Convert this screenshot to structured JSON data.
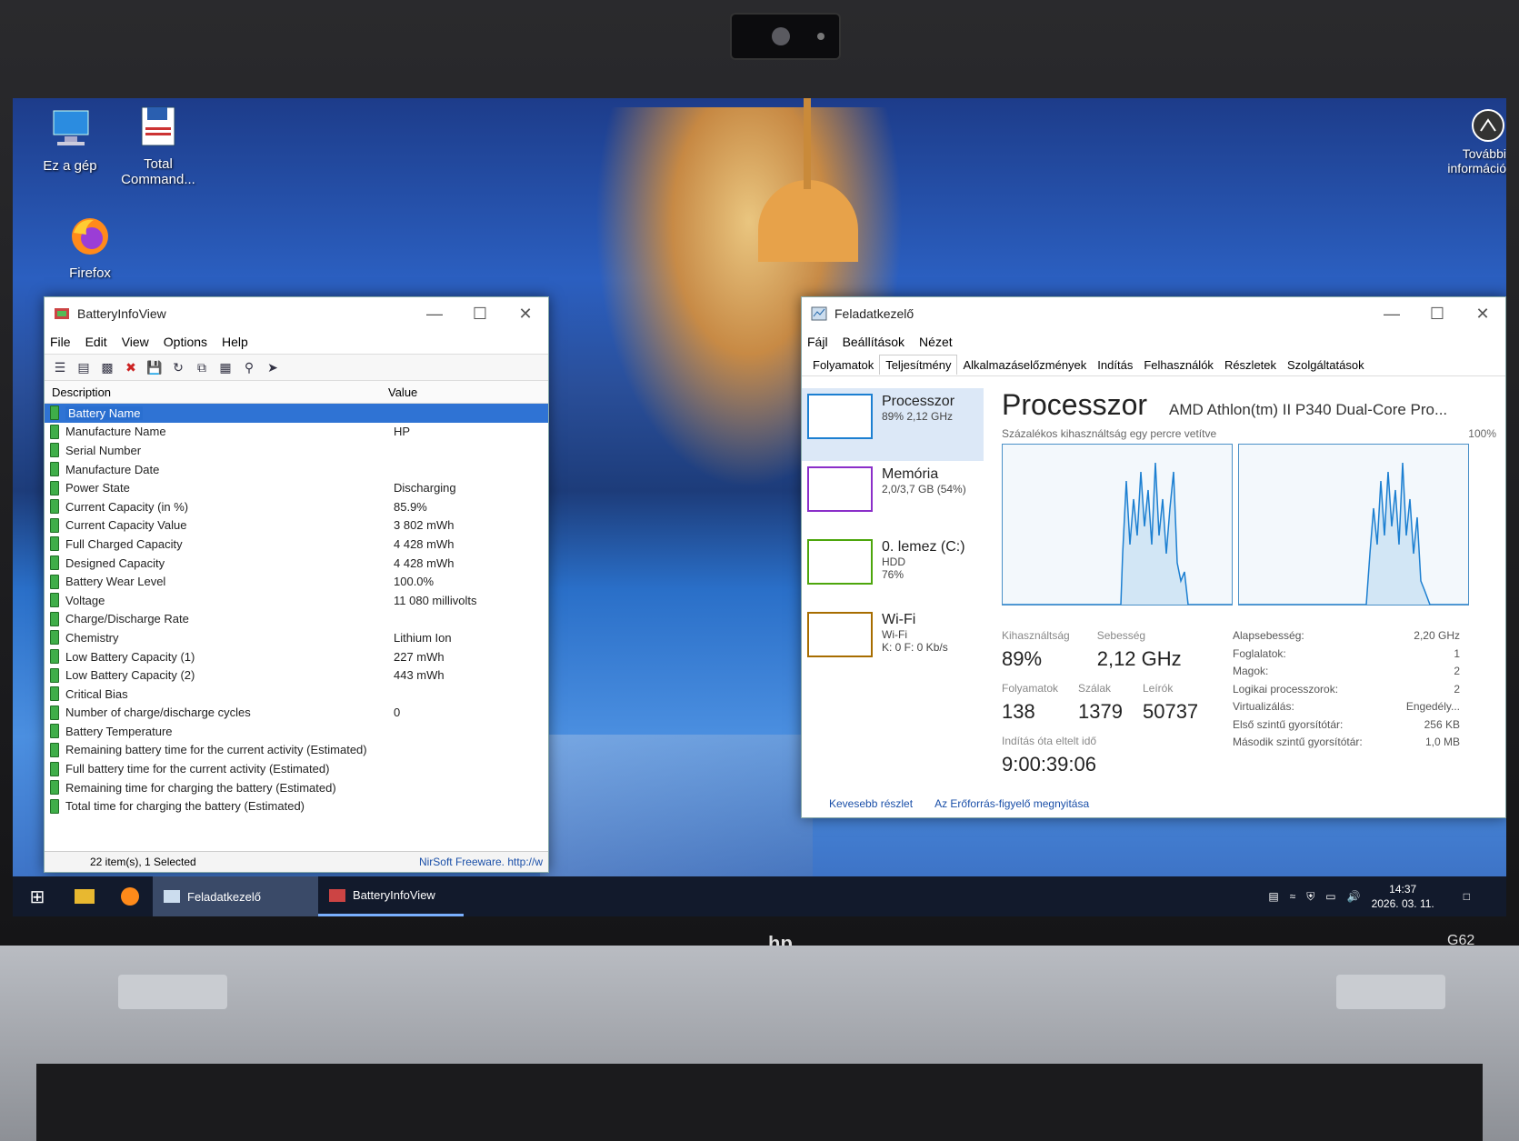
{
  "desktop": {
    "icons": [
      {
        "label": "Ez a gép",
        "icon": "computer-icon"
      },
      {
        "label": "Total Command...",
        "icon": "floppy-icon"
      },
      {
        "label": "Firefox",
        "icon": "firefox-icon"
      }
    ],
    "corner_label_line1": "További",
    "corner_label_line2": "információ"
  },
  "battery_window": {
    "title": "BatteryInfoView",
    "menu": [
      "File",
      "Edit",
      "View",
      "Options",
      "Help"
    ],
    "columns": [
      "Description",
      "Value"
    ],
    "rows": [
      {
        "desc": "Battery Name",
        "value": ""
      },
      {
        "desc": "Manufacture Name",
        "value": "HP"
      },
      {
        "desc": "Serial Number",
        "value": ""
      },
      {
        "desc": "Manufacture Date",
        "value": ""
      },
      {
        "desc": "Power State",
        "value": "Discharging"
      },
      {
        "desc": "Current Capacity (in %)",
        "value": "85.9%"
      },
      {
        "desc": "Current Capacity Value",
        "value": "3 802 mWh"
      },
      {
        "desc": "Full Charged Capacity",
        "value": "4 428 mWh"
      },
      {
        "desc": "Designed Capacity",
        "value": "4 428 mWh"
      },
      {
        "desc": "Battery Wear Level",
        "value": "100.0%"
      },
      {
        "desc": "Voltage",
        "value": "11 080 millivolts"
      },
      {
        "desc": "Charge/Discharge Rate",
        "value": ""
      },
      {
        "desc": "Chemistry",
        "value": "Lithium Ion"
      },
      {
        "desc": "Low Battery Capacity (1)",
        "value": "227 mWh"
      },
      {
        "desc": "Low Battery Capacity (2)",
        "value": "443 mWh"
      },
      {
        "desc": "Critical Bias",
        "value": ""
      },
      {
        "desc": "Number of charge/discharge cycles",
        "value": "0"
      },
      {
        "desc": "Battery Temperature",
        "value": ""
      },
      {
        "desc": "Remaining battery time for the current activity (Estimated)",
        "value": ""
      },
      {
        "desc": "Full battery time for the current activity (Estimated)",
        "value": ""
      },
      {
        "desc": "Remaining time for charging the battery (Estimated)",
        "value": ""
      },
      {
        "desc": "Total  time for charging the battery (Estimated)",
        "value": ""
      }
    ],
    "status_left": "22 item(s), 1 Selected",
    "status_right": "NirSoft Freeware.  http://w"
  },
  "task_manager": {
    "title": "Feladatkezelő",
    "menu": [
      "Fájl",
      "Beállítások",
      "Nézet"
    ],
    "tabs": [
      "Folyamatok",
      "Teljesítmény",
      "Alkalmazáselőzmények",
      "Indítás",
      "Felhasználók",
      "Részletek",
      "Szolgáltatások"
    ],
    "side": [
      {
        "name": "Processzor",
        "sub1": "89% 2,12 GHz",
        "sub2": "",
        "color": "#1c7fd1"
      },
      {
        "name": "Memória",
        "sub1": "2,0/3,7 GB (54%)",
        "sub2": "",
        "color": "#8b2fc9"
      },
      {
        "name": "0. lemez (C:)",
        "sub1": "HDD",
        "sub2": "76%",
        "color": "#4da60c"
      },
      {
        "name": "Wi-Fi",
        "sub1": "Wi-Fi",
        "sub2": "K: 0  F: 0 Kb/s",
        "color": "#a76d00"
      }
    ],
    "heading": "Processzor",
    "cpu_name": "AMD Athlon(tm) II P340 Dual-Core Pro...",
    "graph_caption": "Százalékos kihasználtság egy percre vetítve",
    "graph_max": "100%",
    "util_label": "Kihasználtság",
    "util_value": "89%",
    "speed_label": "Sebesség",
    "speed_value": "2,12 GHz",
    "proc_label": "Folyamatok",
    "proc_value": "138",
    "threads_label": "Szálak",
    "threads_value": "1379",
    "handles_label": "Leírók",
    "handles_value": "50737",
    "uptime_label": "Indítás óta eltelt idő",
    "uptime_value": "9:00:39:06",
    "details": [
      {
        "k": "Alapsebesség:",
        "v": "2,20 GHz"
      },
      {
        "k": "Foglalatok:",
        "v": "1"
      },
      {
        "k": "Magok:",
        "v": "2"
      },
      {
        "k": "Logikai processzorok:",
        "v": "2"
      },
      {
        "k": "Virtualizálás:",
        "v": "Engedély..."
      },
      {
        "k": "Első szintű gyorsítótár:",
        "v": "256 KB"
      },
      {
        "k": "Második szintű gyorsítótár:",
        "v": "1,0 MB"
      }
    ],
    "less_detail": "Kevesebb részlet",
    "resmon": "Az Erőforrás-figyelő megnyitása"
  },
  "taskbar": {
    "items": [
      "Feladatkezelő",
      "BatteryInfoView"
    ],
    "time": "14:37",
    "date": "2026. 03. 11."
  },
  "laptop": {
    "brand": "hp",
    "model": "G62"
  }
}
